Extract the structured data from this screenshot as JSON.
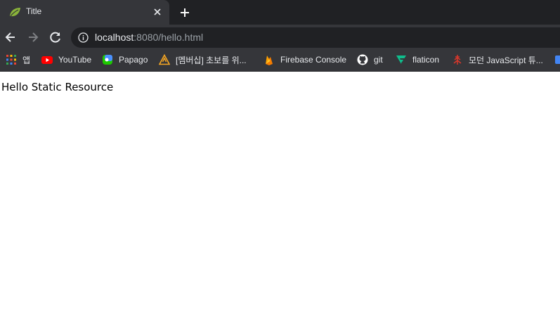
{
  "tab": {
    "title": "Title",
    "favicon": "spring-leaf-icon",
    "active_color": "#35363a"
  },
  "address_bar": {
    "host": "localhost",
    "rest": ":8080/hello.html"
  },
  "bookmarks": [
    {
      "label": "앱",
      "icon": "apps-grid-icon"
    },
    {
      "label": "YouTube",
      "icon": "youtube-icon"
    },
    {
      "label": "Papago",
      "icon": "papago-icon"
    },
    {
      "label": "[멤버십] 초보를 위...",
      "icon": "warning-triangle-icon"
    },
    {
      "label": "Firebase Console",
      "icon": "firebase-icon"
    },
    {
      "label": "git",
      "icon": "github-icon"
    },
    {
      "label": "flaticon",
      "icon": "flaticon-icon"
    },
    {
      "label": "모던 JavaScript 튜...",
      "icon": "js-tutorial-icon"
    }
  ],
  "page": {
    "text": "Hello Static Resource"
  },
  "colors": {
    "tabstrip_bg": "#202124",
    "toolbar_bg": "#35363a",
    "omnibox_bg": "#202124",
    "text_light": "#e8eaed",
    "text_dim": "#9aa0a6"
  }
}
